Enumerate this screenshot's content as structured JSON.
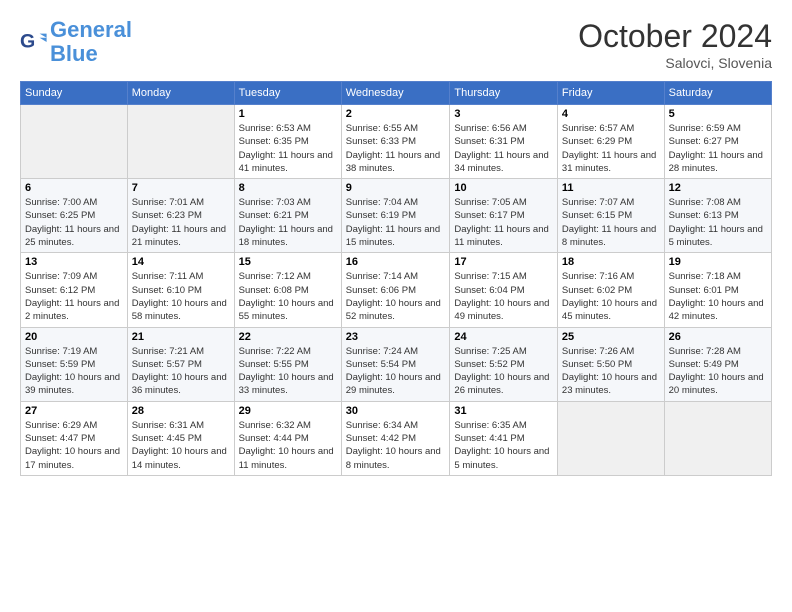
{
  "logo": {
    "text_general": "General",
    "text_blue": "Blue"
  },
  "header": {
    "month": "October 2024",
    "location": "Salovci, Slovenia"
  },
  "weekdays": [
    "Sunday",
    "Monday",
    "Tuesday",
    "Wednesday",
    "Thursday",
    "Friday",
    "Saturday"
  ],
  "weeks": [
    [
      {
        "day": "",
        "sunrise": "",
        "sunset": "",
        "daylight": ""
      },
      {
        "day": "",
        "sunrise": "",
        "sunset": "",
        "daylight": ""
      },
      {
        "day": "1",
        "sunrise": "Sunrise: 6:53 AM",
        "sunset": "Sunset: 6:35 PM",
        "daylight": "Daylight: 11 hours and 41 minutes."
      },
      {
        "day": "2",
        "sunrise": "Sunrise: 6:55 AM",
        "sunset": "Sunset: 6:33 PM",
        "daylight": "Daylight: 11 hours and 38 minutes."
      },
      {
        "day": "3",
        "sunrise": "Sunrise: 6:56 AM",
        "sunset": "Sunset: 6:31 PM",
        "daylight": "Daylight: 11 hours and 34 minutes."
      },
      {
        "day": "4",
        "sunrise": "Sunrise: 6:57 AM",
        "sunset": "Sunset: 6:29 PM",
        "daylight": "Daylight: 11 hours and 31 minutes."
      },
      {
        "day": "5",
        "sunrise": "Sunrise: 6:59 AM",
        "sunset": "Sunset: 6:27 PM",
        "daylight": "Daylight: 11 hours and 28 minutes."
      }
    ],
    [
      {
        "day": "6",
        "sunrise": "Sunrise: 7:00 AM",
        "sunset": "Sunset: 6:25 PM",
        "daylight": "Daylight: 11 hours and 25 minutes."
      },
      {
        "day": "7",
        "sunrise": "Sunrise: 7:01 AM",
        "sunset": "Sunset: 6:23 PM",
        "daylight": "Daylight: 11 hours and 21 minutes."
      },
      {
        "day": "8",
        "sunrise": "Sunrise: 7:03 AM",
        "sunset": "Sunset: 6:21 PM",
        "daylight": "Daylight: 11 hours and 18 minutes."
      },
      {
        "day": "9",
        "sunrise": "Sunrise: 7:04 AM",
        "sunset": "Sunset: 6:19 PM",
        "daylight": "Daylight: 11 hours and 15 minutes."
      },
      {
        "day": "10",
        "sunrise": "Sunrise: 7:05 AM",
        "sunset": "Sunset: 6:17 PM",
        "daylight": "Daylight: 11 hours and 11 minutes."
      },
      {
        "day": "11",
        "sunrise": "Sunrise: 7:07 AM",
        "sunset": "Sunset: 6:15 PM",
        "daylight": "Daylight: 11 hours and 8 minutes."
      },
      {
        "day": "12",
        "sunrise": "Sunrise: 7:08 AM",
        "sunset": "Sunset: 6:13 PM",
        "daylight": "Daylight: 11 hours and 5 minutes."
      }
    ],
    [
      {
        "day": "13",
        "sunrise": "Sunrise: 7:09 AM",
        "sunset": "Sunset: 6:12 PM",
        "daylight": "Daylight: 11 hours and 2 minutes."
      },
      {
        "day": "14",
        "sunrise": "Sunrise: 7:11 AM",
        "sunset": "Sunset: 6:10 PM",
        "daylight": "Daylight: 10 hours and 58 minutes."
      },
      {
        "day": "15",
        "sunrise": "Sunrise: 7:12 AM",
        "sunset": "Sunset: 6:08 PM",
        "daylight": "Daylight: 10 hours and 55 minutes."
      },
      {
        "day": "16",
        "sunrise": "Sunrise: 7:14 AM",
        "sunset": "Sunset: 6:06 PM",
        "daylight": "Daylight: 10 hours and 52 minutes."
      },
      {
        "day": "17",
        "sunrise": "Sunrise: 7:15 AM",
        "sunset": "Sunset: 6:04 PM",
        "daylight": "Daylight: 10 hours and 49 minutes."
      },
      {
        "day": "18",
        "sunrise": "Sunrise: 7:16 AM",
        "sunset": "Sunset: 6:02 PM",
        "daylight": "Daylight: 10 hours and 45 minutes."
      },
      {
        "day": "19",
        "sunrise": "Sunrise: 7:18 AM",
        "sunset": "Sunset: 6:01 PM",
        "daylight": "Daylight: 10 hours and 42 minutes."
      }
    ],
    [
      {
        "day": "20",
        "sunrise": "Sunrise: 7:19 AM",
        "sunset": "Sunset: 5:59 PM",
        "daylight": "Daylight: 10 hours and 39 minutes."
      },
      {
        "day": "21",
        "sunrise": "Sunrise: 7:21 AM",
        "sunset": "Sunset: 5:57 PM",
        "daylight": "Daylight: 10 hours and 36 minutes."
      },
      {
        "day": "22",
        "sunrise": "Sunrise: 7:22 AM",
        "sunset": "Sunset: 5:55 PM",
        "daylight": "Daylight: 10 hours and 33 minutes."
      },
      {
        "day": "23",
        "sunrise": "Sunrise: 7:24 AM",
        "sunset": "Sunset: 5:54 PM",
        "daylight": "Daylight: 10 hours and 29 minutes."
      },
      {
        "day": "24",
        "sunrise": "Sunrise: 7:25 AM",
        "sunset": "Sunset: 5:52 PM",
        "daylight": "Daylight: 10 hours and 26 minutes."
      },
      {
        "day": "25",
        "sunrise": "Sunrise: 7:26 AM",
        "sunset": "Sunset: 5:50 PM",
        "daylight": "Daylight: 10 hours and 23 minutes."
      },
      {
        "day": "26",
        "sunrise": "Sunrise: 7:28 AM",
        "sunset": "Sunset: 5:49 PM",
        "daylight": "Daylight: 10 hours and 20 minutes."
      }
    ],
    [
      {
        "day": "27",
        "sunrise": "Sunrise: 6:29 AM",
        "sunset": "Sunset: 4:47 PM",
        "daylight": "Daylight: 10 hours and 17 minutes."
      },
      {
        "day": "28",
        "sunrise": "Sunrise: 6:31 AM",
        "sunset": "Sunset: 4:45 PM",
        "daylight": "Daylight: 10 hours and 14 minutes."
      },
      {
        "day": "29",
        "sunrise": "Sunrise: 6:32 AM",
        "sunset": "Sunset: 4:44 PM",
        "daylight": "Daylight: 10 hours and 11 minutes."
      },
      {
        "day": "30",
        "sunrise": "Sunrise: 6:34 AM",
        "sunset": "Sunset: 4:42 PM",
        "daylight": "Daylight: 10 hours and 8 minutes."
      },
      {
        "day": "31",
        "sunrise": "Sunrise: 6:35 AM",
        "sunset": "Sunset: 4:41 PM",
        "daylight": "Daylight: 10 hours and 5 minutes."
      },
      {
        "day": "",
        "sunrise": "",
        "sunset": "",
        "daylight": ""
      },
      {
        "day": "",
        "sunrise": "",
        "sunset": "",
        "daylight": ""
      }
    ]
  ]
}
